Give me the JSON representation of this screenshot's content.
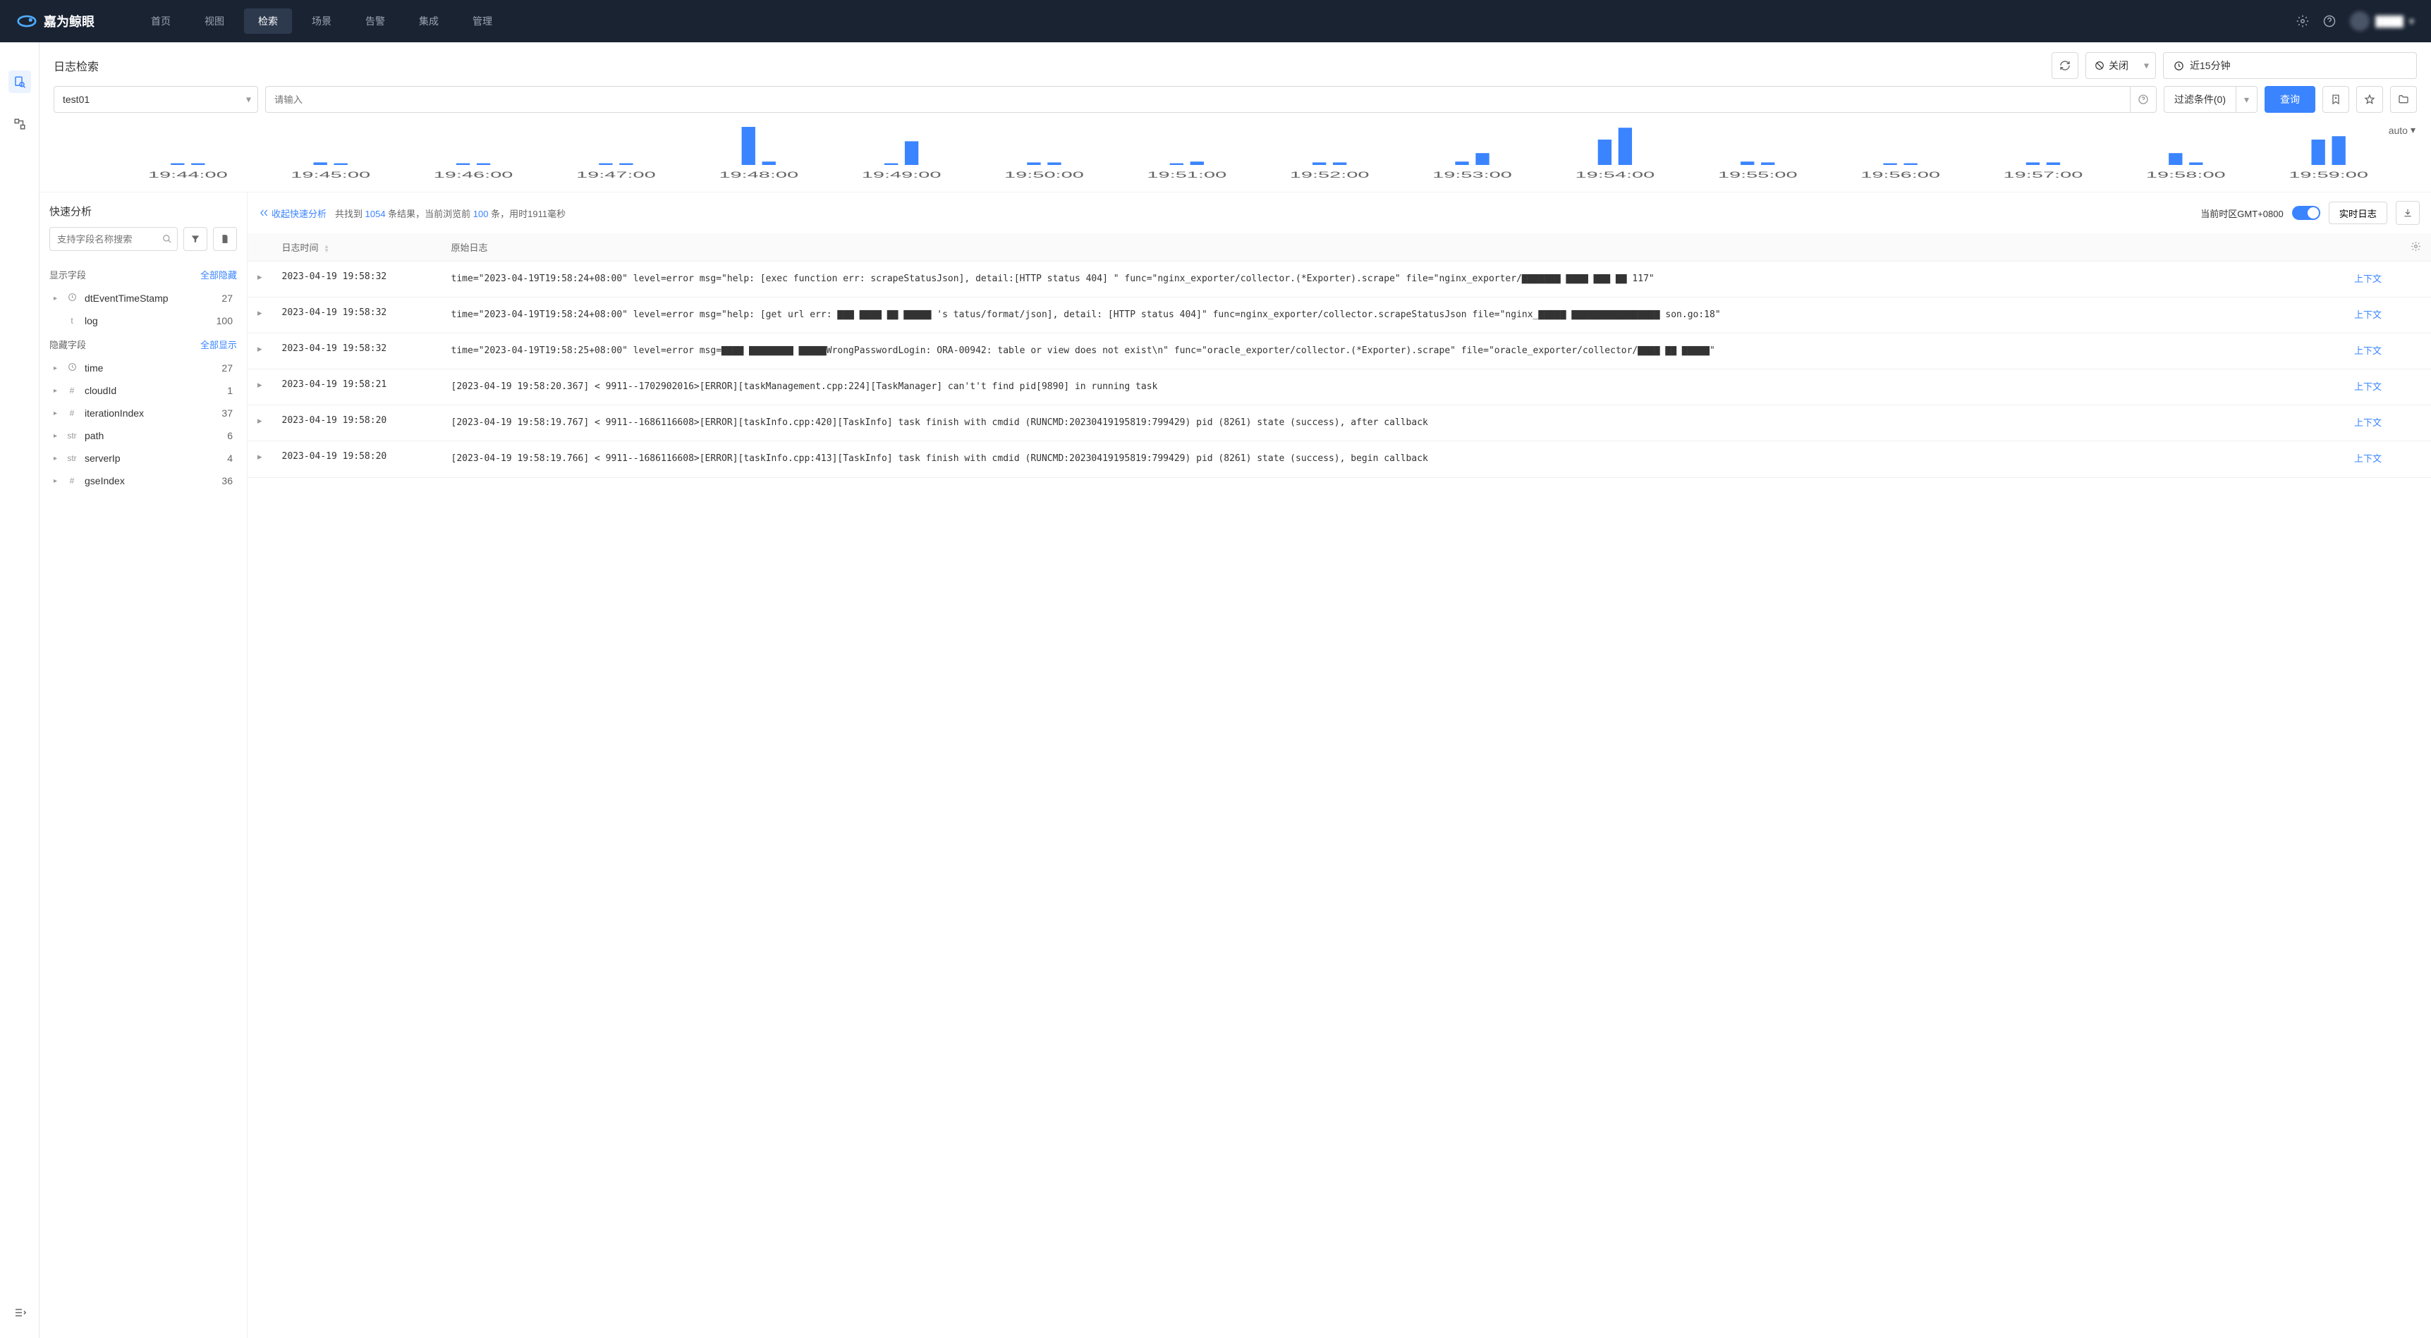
{
  "brand": "嘉为鲸眼",
  "nav": [
    "首页",
    "视图",
    "检索",
    "场景",
    "告警",
    "集成",
    "管理"
  ],
  "nav_active_index": 2,
  "page_title": "日志检索",
  "close_button": {
    "label": "关闭"
  },
  "time_range": {
    "label": "近15分钟"
  },
  "source_select": {
    "value": "test01"
  },
  "search": {
    "placeholder": "请输入"
  },
  "filter": {
    "label": "过滤条件(0)"
  },
  "query_button": "查询",
  "chart_mode": "auto",
  "chart_data": {
    "type": "bar",
    "xlabel": "",
    "ylabel": "",
    "ylim": [
      0,
      50
    ],
    "categories": [
      "19:44:00",
      "19:45:00",
      "19:46:00",
      "19:47:00",
      "19:48:00",
      "19:49:00",
      "19:50:00",
      "19:51:00",
      "19:52:00",
      "19:53:00",
      "19:54:00",
      "19:55:00",
      "19:56:00",
      "19:57:00",
      "19:58:00",
      "19:59:00"
    ],
    "values_dense": [
      2,
      2,
      3,
      2,
      2,
      2,
      2,
      2,
      45,
      4,
      2,
      28,
      3,
      3,
      2,
      4,
      3,
      3,
      4,
      14,
      30,
      44,
      4,
      3,
      2,
      2,
      3,
      3,
      14,
      3,
      30,
      34
    ]
  },
  "quick_analysis": {
    "title": "快速分析",
    "search_placeholder": "支持字段名称搜索",
    "show_section": "显示字段",
    "hide_all": "全部隐藏",
    "hide_section": "隐藏字段",
    "show_all": "全部显示",
    "show_fields": [
      {
        "type": "clock",
        "name": "dtEventTimeStamp",
        "count": 27
      },
      {
        "type": "t",
        "name": "log",
        "count": 100
      }
    ],
    "hide_fields": [
      {
        "type": "clock",
        "name": "time",
        "count": 27
      },
      {
        "type": "#",
        "name": "cloudId",
        "count": 1
      },
      {
        "type": "#",
        "name": "iterationIndex",
        "count": 37
      },
      {
        "type": "str",
        "name": "path",
        "count": 6
      },
      {
        "type": "str",
        "name": "serverIp",
        "count": 4
      },
      {
        "type": "#",
        "name": "gseIndex",
        "count": 36
      }
    ]
  },
  "results_bar": {
    "collapse": "收起快速分析",
    "stats_prefix": "共找到 ",
    "total": 1054,
    "stats_mid": " 条结果，当前浏览前 ",
    "shown": 100,
    "stats_tail": " 条，用时1911毫秒",
    "tz_label": "当前时区GMT+0800",
    "realtime": "实时日志"
  },
  "table": {
    "col_time": "日志时间",
    "col_raw": "原始日志",
    "context": "上下文",
    "rows": [
      {
        "time": "2023-04-19 19:58:32",
        "raw": "time=\"2023-04-19T19:58:24+08:00\" level=error msg=\"help: [exec function err: scrapeStatusJson], detail:[HTTP status 404] \" func=\"nginx_exporter/collector.(*Exporter).scrape\" file=\"nginx_exporter/▇▇▇▇▇▇▇ ▇▇▇▇ ▇▇▇ ▇▇ 117\""
      },
      {
        "time": "2023-04-19 19:58:32",
        "raw": "time=\"2023-04-19T19:58:24+08:00\" level=error msg=\"help: [get url err: ▇▇▇ ▇▇▇▇ ▇▇ ▇▇▇▇▇ 's tatus/format/json], detail: [HTTP status 404]\" func=nginx_exporter/collector.scrapeStatusJson file=\"nginx_▇▇▇▇▇ ▇▇▇▇▇▇▇▇▇▇▇▇▇▇▇▇ son.go:18\""
      },
      {
        "time": "2023-04-19 19:58:32",
        "raw": "time=\"2023-04-19T19:58:25+08:00\" level=error msg=▇▇▇▇  ▇▇▇▇▇▇▇▇  ▇▇▇▇▇WrongPasswordLogin: ORA-00942: table or view does not exist\\n\" func=\"oracle_exporter/collector.(*Exporter).scrape\" file=\"oracle_exporter/collector/▇▇▇▇ ▇▇ ▇▇▇▇▇\""
      },
      {
        "time": "2023-04-19 19:58:21",
        "raw": "[2023-04-19 19:58:20.367] < 9911--1702902016>[ERROR][taskManagement.cpp:224][TaskManager] can't't find pid[9890] in running task"
      },
      {
        "time": "2023-04-19 19:58:20",
        "raw": "[2023-04-19 19:58:19.767] < 9911--1686116608>[ERROR][taskInfo.cpp:420][TaskInfo] task finish with cmdid (RUNCMD:20230419195819:799429) pid (8261) state  (success), after callback"
      },
      {
        "time": "2023-04-19 19:58:20",
        "raw": "[2023-04-19 19:58:19.766] < 9911--1686116608>[ERROR][taskInfo.cpp:413][TaskInfo] task finish with cmdid (RUNCMD:20230419195819:799429) pid  (8261) state  (success), begin callback"
      }
    ]
  }
}
